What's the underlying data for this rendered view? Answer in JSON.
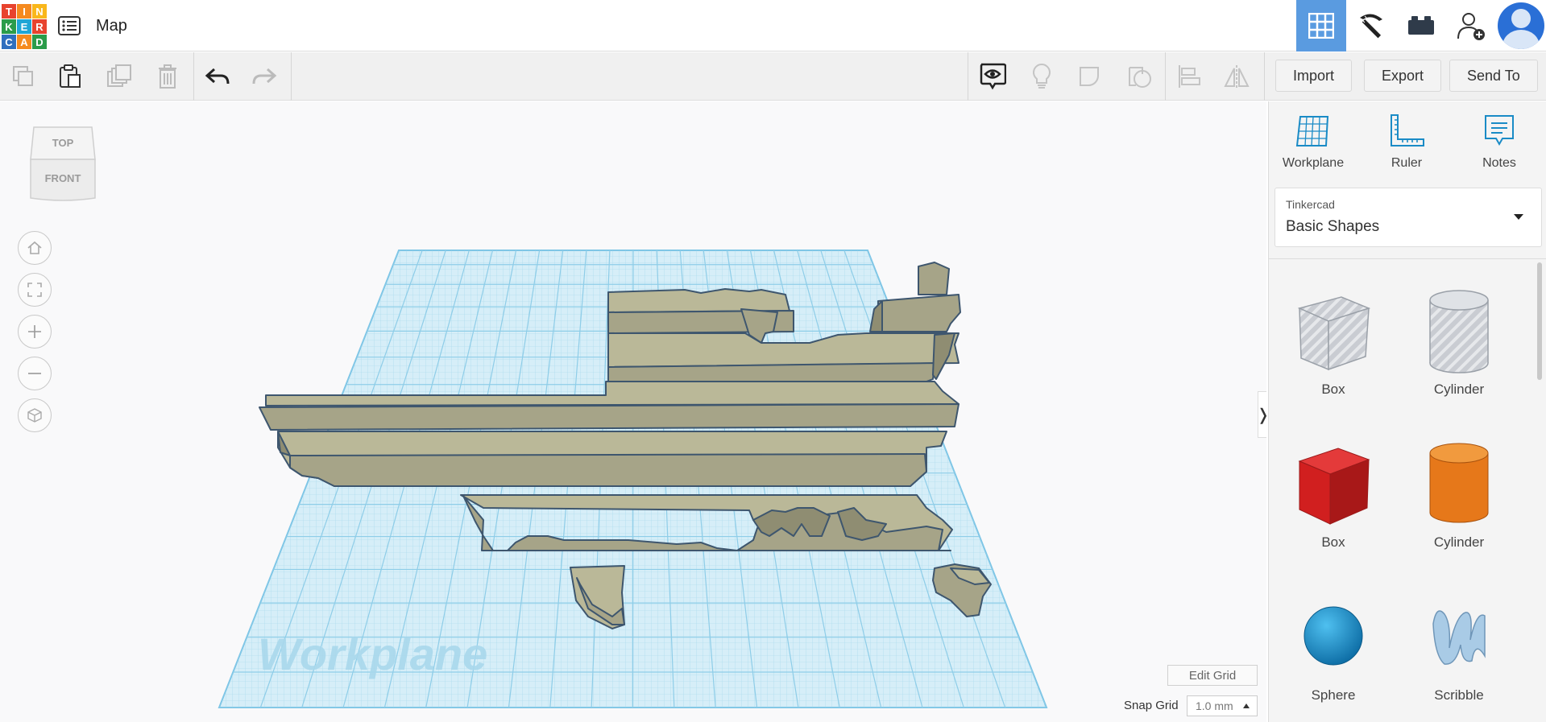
{
  "logo": {
    "letters": [
      "T",
      "I",
      "N",
      "K",
      "E",
      "R",
      "C",
      "A",
      "D"
    ],
    "colors": [
      "#e8432e",
      "#f58a1f",
      "#f9b71b",
      "#2b9c4a",
      "#1fa6d6",
      "#e8432e",
      "#2f6fbf",
      "#f58a1f",
      "#2b9c4a"
    ]
  },
  "header": {
    "title": "Map",
    "menu_icon": "list-icon"
  },
  "top_right": {
    "buttons": [
      "3d-design-icon",
      "pickaxe-icon",
      "bricks-icon",
      "add-user-icon",
      "avatar"
    ],
    "active_color": "#5a9be0"
  },
  "toolbar": {
    "import_label": "Import",
    "export_label": "Export",
    "send_to_label": "Send To"
  },
  "viewcube": {
    "top_label": "TOP",
    "front_label": "FRONT"
  },
  "workplane_label": "Workplane",
  "viewport_controls": {
    "edit_grid_label": "Edit Grid",
    "snap_grid_label": "Snap Grid",
    "snap_grid_value": "1.0 mm",
    "collapse_glyph": "❭"
  },
  "panel": {
    "tools": [
      {
        "label": "Workplane",
        "icon": "workplane-icon"
      },
      {
        "label": "Ruler",
        "icon": "ruler-icon"
      },
      {
        "label": "Notes",
        "icon": "notes-icon"
      }
    ],
    "library": {
      "provider": "Tinkercad",
      "category": "Basic Shapes"
    },
    "shapes": [
      {
        "label": "Box",
        "icon": "box-hole-icon"
      },
      {
        "label": "Cylinder",
        "icon": "cylinder-hole-icon"
      },
      {
        "label": "Box",
        "icon": "box-red-icon"
      },
      {
        "label": "Cylinder",
        "icon": "cylinder-orange-icon"
      },
      {
        "label": "Sphere",
        "icon": "sphere-blue-icon"
      },
      {
        "label": "Scribble",
        "icon": "scribble-icon"
      }
    ]
  },
  "colors": {
    "grid": "#7fc6e6",
    "grid_fill": "#d4edf7",
    "model": "#a6a488",
    "model_edge": "#3e566e",
    "box_red": "#d81f1f",
    "cylinder_orange": "#e6781a",
    "sphere_blue": "#1a8bc6"
  }
}
